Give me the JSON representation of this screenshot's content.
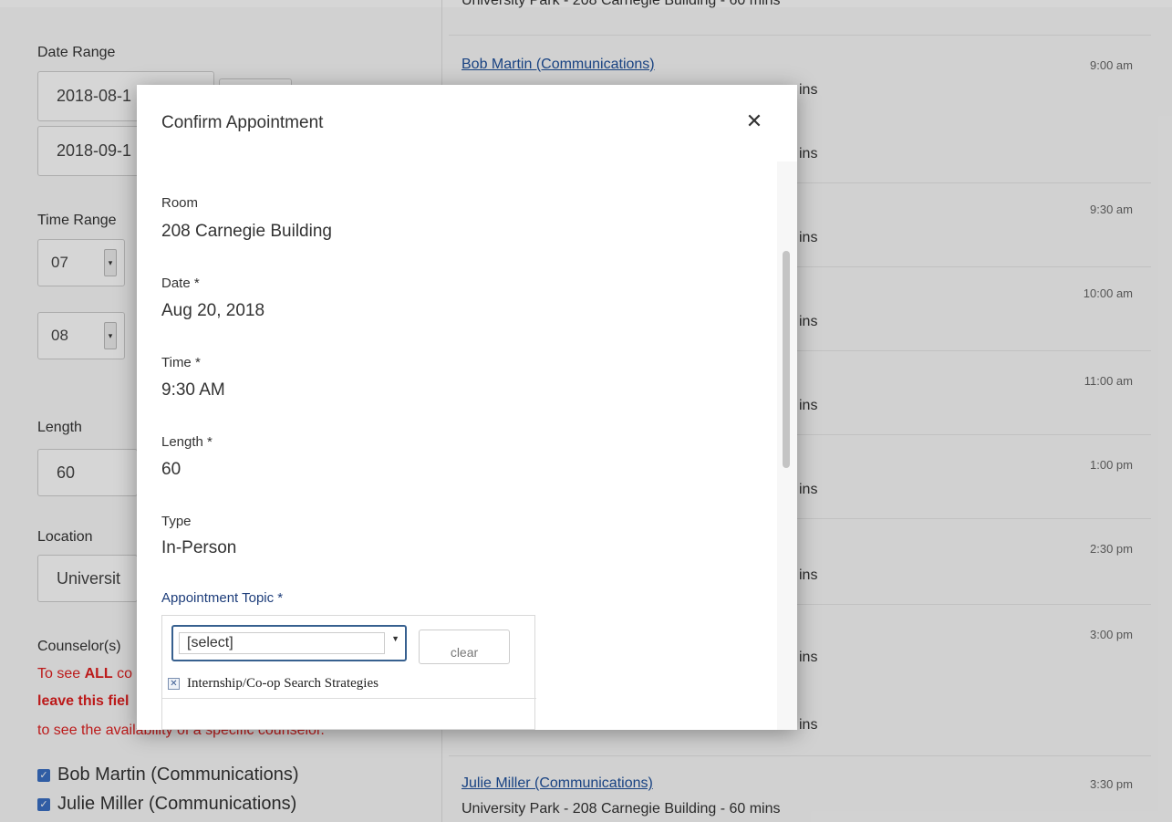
{
  "sidebar": {
    "date_range_label": "Date Range",
    "start_date": "2018-08-1",
    "end_date": "2018-09-1",
    "time_range_label": "Time Range",
    "time_start_hour": "07",
    "time_end_hour": "08",
    "length_label": "Length",
    "length_value": "60",
    "location_label": "Location",
    "location_value": "Universit",
    "counselor_label": "Counselor(s)",
    "notice_line1_prefix": "To see ",
    "notice_line1_bold": "ALL",
    "notice_line1_suffix": " co",
    "notice_line2": "leave this fiel",
    "notice_line3": "to see the availability of a specific counselor.",
    "counselors": [
      {
        "name": "Bob Martin (Communications)",
        "checked": true
      },
      {
        "name": "Julie Miller (Communications)",
        "checked": true
      }
    ]
  },
  "slots": {
    "top_partial_detail": "University Park - 208 Carnegie Building - 60 mins",
    "items": [
      {
        "name": "Bob Martin (Communications)",
        "time": "9:00 am",
        "ins": "ins"
      },
      {
        "time": "",
        "ins": "ins"
      },
      {
        "time": "9:30 am",
        "ins": "ins"
      },
      {
        "time": "10:00 am",
        "ins": "ins"
      },
      {
        "time": "11:00 am",
        "ins": "ins"
      },
      {
        "time": "1:00 pm",
        "ins": "ins"
      },
      {
        "time": "2:30 pm",
        "ins": "ins"
      },
      {
        "time": "3:00 pm",
        "ins": "ins"
      },
      {
        "time": "",
        "ins": "ins"
      }
    ],
    "last_name": "Julie Miller (Communications)",
    "last_time": "3:30 pm",
    "last_detail": "University Park - 208 Carnegie Building - 60 mins"
  },
  "modal": {
    "title": "Confirm Appointment",
    "close_symbol": "✕",
    "fields": {
      "room_label": "Room",
      "room_value": "208 Carnegie Building",
      "date_label": "Date *",
      "date_value": "Aug 20, 2018",
      "time_label": "Time *",
      "time_value": "9:30 AM",
      "length_label": "Length *",
      "length_value": "60",
      "type_label": "Type",
      "type_value": "In-Person"
    },
    "topic": {
      "label": "Appointment Topic *",
      "select_value": "[select]",
      "clear_label": "clear",
      "selected_items": [
        "Internship/Co-op Search Strategies"
      ],
      "remove_symbol": "✕"
    }
  },
  "colors": {
    "link": "#1d4f9b",
    "warning_red": "#e02020",
    "checkbox_blue": "#3a6fc4"
  }
}
